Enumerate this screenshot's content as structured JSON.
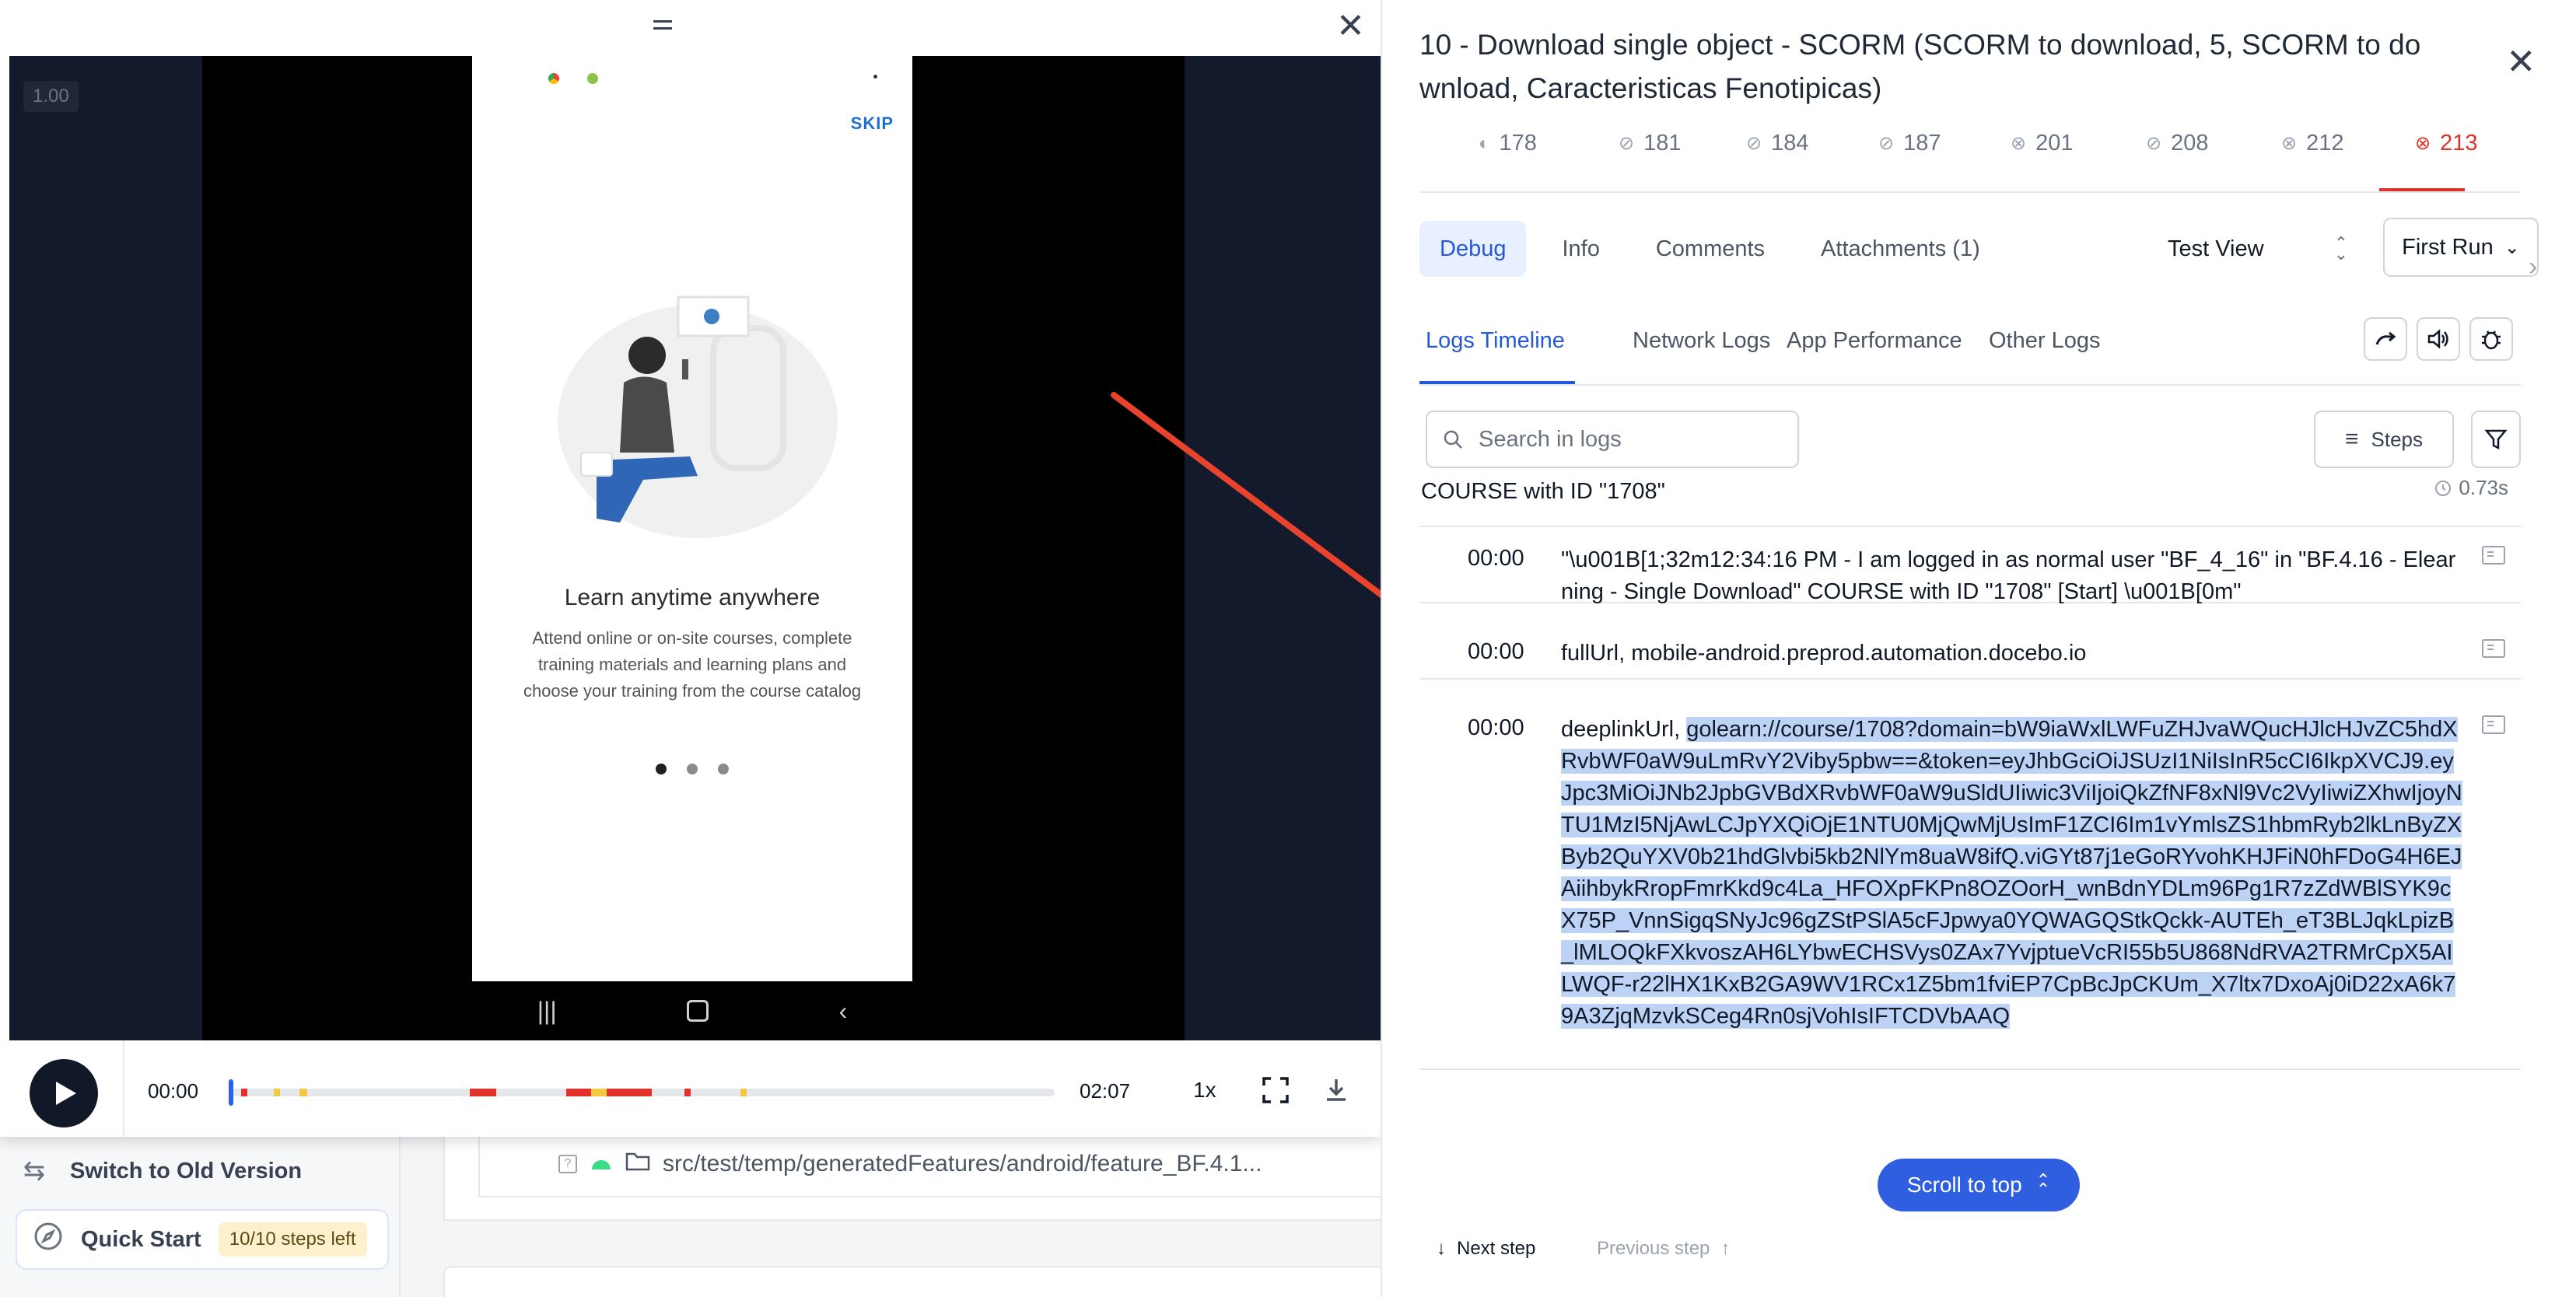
{
  "background": {
    "sidebar": {
      "switch_version": "Switch to Old Version",
      "quick_start": "Quick Start",
      "quick_start_badge": "10/10 steps left"
    },
    "file_path": "src/test/temp/generatedFeatures/android/feature_BF.4.1..."
  },
  "player": {
    "speed_tag": "1.00",
    "phone": {
      "skip": "SKIP",
      "title": "Learn anytime anywhere",
      "description": "Attend online or on-site courses, complete training materials and learning plans and choose your training from the course catalog"
    },
    "controls": {
      "current_time": "00:00",
      "total_time": "02:07",
      "speed": "1x"
    }
  },
  "panel": {
    "title": "10 - Download single object - SCORM (SCORM to download, 5, SCORM to download, Caracteristicas Fenotipicas)",
    "run_tabs": [
      {
        "label": "178",
        "status": "partial"
      },
      {
        "label": "181",
        "status": "passed"
      },
      {
        "label": "184",
        "status": "passed"
      },
      {
        "label": "187",
        "status": "passed"
      },
      {
        "label": "201",
        "status": "failed"
      },
      {
        "label": "208",
        "status": "passed"
      },
      {
        "label": "212",
        "status": "failed"
      },
      {
        "label": "213",
        "status": "failed"
      }
    ],
    "sub_tabs": [
      "Debug",
      "Info",
      "Comments",
      "Attachments (1)"
    ],
    "view_select": "Test View",
    "run_select": "First Run",
    "log_tabs": [
      "Logs Timeline",
      "Network Logs",
      "App Performance",
      "Other Logs"
    ],
    "search_placeholder": "Search in logs",
    "steps_button": "Steps",
    "logs": [
      {
        "time": "",
        "text": "COURSE with ID \"1708\"",
        "duration": "0.73s"
      },
      {
        "time": "00:00",
        "text": "\"\\u001B[1;32m12:34:16 PM - I am logged in as normal user \"BF_4_16\" in \"BF.4.16 - Elearning - Single Download\" COURSE with ID \"1708\" [Start] \\u001B[0m\""
      },
      {
        "time": "00:00",
        "text": "fullUrl, mobile-android.preprod.automation.docebo.io"
      },
      {
        "time": "00:00",
        "prefix": "deeplinkUrl, ",
        "highlight": "golearn://course/1708?domain=bW9iaWxlLWFuZHJvaWQucHJlcHJvZC5hdXRvbWF0aW9uLmRvY2Viby5pbw==&token=eyJhbGciOiJSUzI1NiIsInR5cCI6IkpXVCJ9.eyJpc3MiOiJNb2JpbGVBdXRvbWF0aW9uSldUIiwic3ViIjoiQkZfNF8xNl9Vc2VyIiwiZXhwIjoyNTU1MzI5NjAwLCJpYXQiOjE1NTU0MjQwMjUsImF1ZCI6Im1vYmlsZS1hbmRyb2lkLnByZXByb2QuYXV0b21hdGlvbi5kb2NlYm8uaW8ifQ.viGYt87j1eGoRYvohKHJFiN0hFDoG4H6EJAiihbykRropFmrKkd9c4La_HFOXpFKPn8OZOorH_wnBdnYDLm96Pg1R7zZdWBlSYK9cX75P_VnnSigqSNyJc96gZStPSlA5cFJpwya0YQWAGQStkQckk-AUTEh_eT3BLJqkLpizB_lMLOQkFXkvoszAH6LYbwECHSVys0ZAx7YvjptueVcRI55b5U868NdRVA2TRMrCpX5AILWQF-r22lHX1KxB2GA9WV1RCx1Z5bm1fviEP7CpBcJpCKUm_X7ltx7DxoAj0iD22xA6k79A3ZjqMzvkSCeg4Rn0sjVohIsIFTCDVbAAQ"
      }
    ],
    "scroll_to_top": "Scroll to top",
    "next_step": "Next step",
    "previous_step": "Previous step"
  },
  "colors": {
    "accent": "#2559d8",
    "failed": "#e0322b",
    "highlight": "#bcd3f5",
    "scroll_button": "#2f5fe0"
  }
}
